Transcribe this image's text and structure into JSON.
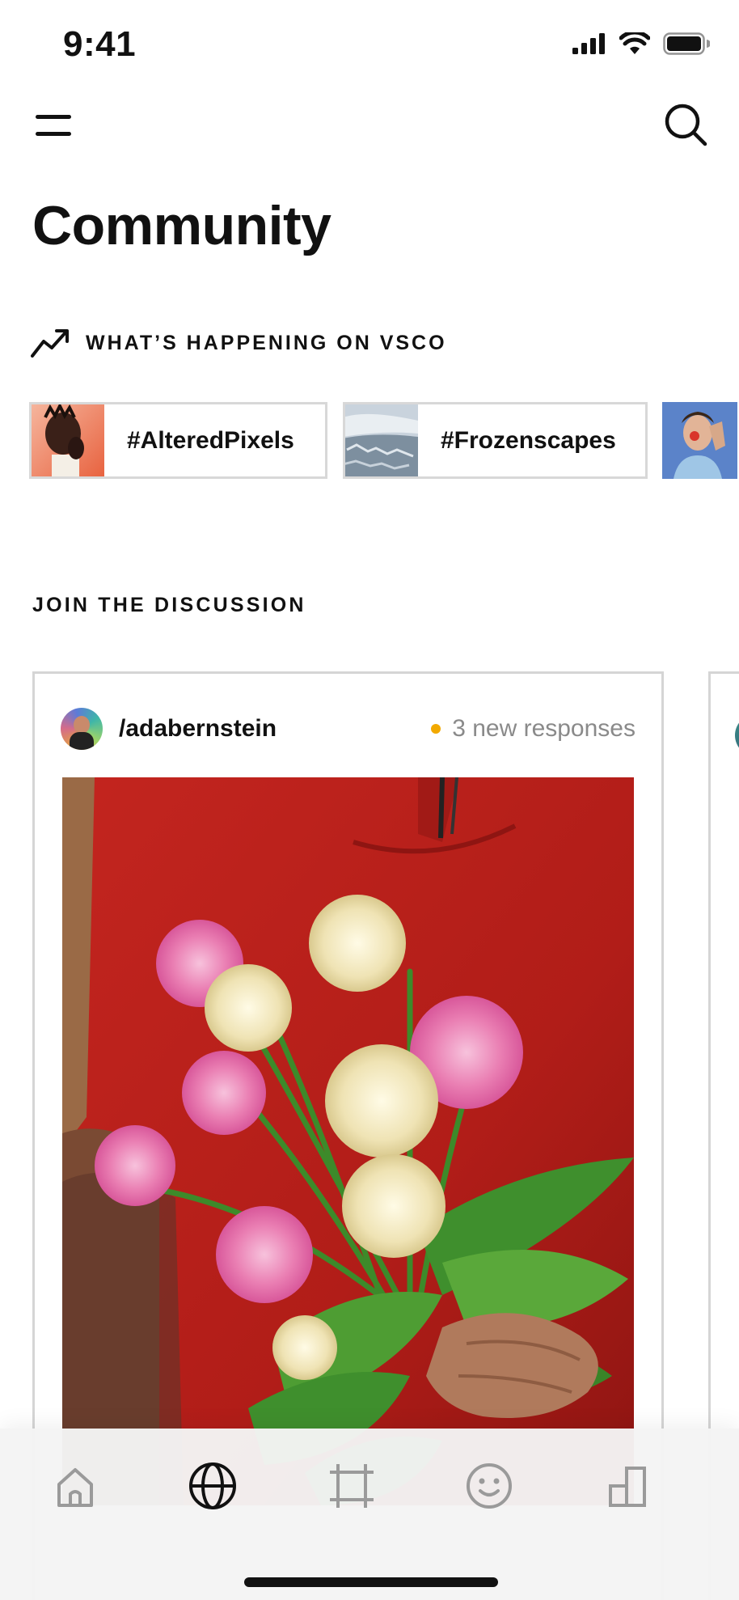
{
  "status_bar": {
    "time": "9:41"
  },
  "header": {
    "menu_icon": "menu-icon",
    "search_icon": "search-icon",
    "title": "Community"
  },
  "trending": {
    "icon": "trending-up-icon",
    "title": "WHAT’S HAPPENING ON VSCO",
    "chips": [
      {
        "label": "#AlteredPixels"
      },
      {
        "label": "#Frozenscapes"
      },
      {
        "label": ""
      }
    ]
  },
  "discussion": {
    "title": "JOIN THE DISCUSSION",
    "posts": [
      {
        "username": "/adabernstein",
        "responses": "3 new responses",
        "dot_color": "#f2a900"
      }
    ]
  },
  "tab_bar": {
    "tabs": [
      {
        "name": "home",
        "icon": "home-icon"
      },
      {
        "name": "community",
        "icon": "globe-icon",
        "active": true
      },
      {
        "name": "studio",
        "icon": "crop-icon"
      },
      {
        "name": "profile",
        "icon": "smiley-icon"
      },
      {
        "name": "stats",
        "icon": "bar-chart-icon"
      }
    ]
  }
}
